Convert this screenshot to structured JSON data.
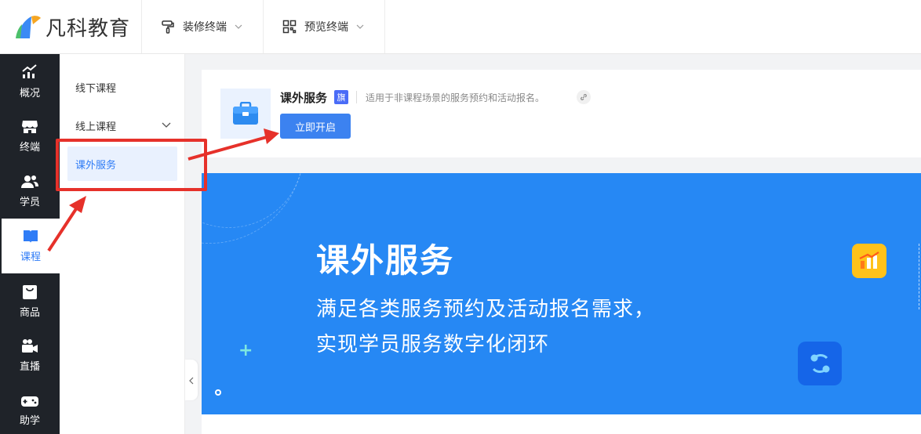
{
  "brand": {
    "name": "凡科教育"
  },
  "top_menu": [
    {
      "label": "装修终端",
      "icon": "paint-roller-icon"
    },
    {
      "label": "预览终端",
      "icon": "qr-code-icon"
    }
  ],
  "left_nav": [
    {
      "label": "概况",
      "icon": "chart-icon"
    },
    {
      "label": "终端",
      "icon": "store-icon"
    },
    {
      "label": "学员",
      "icon": "users-icon"
    },
    {
      "label": "课程",
      "icon": "book-icon",
      "active": true
    },
    {
      "label": "商品",
      "icon": "bag-icon"
    },
    {
      "label": "直播",
      "icon": "video-camera-icon"
    },
    {
      "label": "助学",
      "icon": "gamepad-icon"
    }
  ],
  "sub_nav": [
    {
      "label": "线下课程"
    },
    {
      "label": "线上课程",
      "expandable": true
    },
    {
      "label": "课外服务",
      "active": true
    }
  ],
  "card": {
    "title": "课外服务",
    "badge": "旗",
    "description": "适用于非课程场景的服务预约和活动报名。",
    "button_label": "立即开启"
  },
  "banner": {
    "title": "课外服务",
    "line1": "满足各类服务预约及活动报名需求，",
    "line2": "实现学员服务数字化闭环",
    "plus": "+"
  },
  "colors": {
    "primary": "#2f7cf6",
    "banner_bg": "#2688f4",
    "nav_bg": "#1f2329",
    "annotation": "#e6312a",
    "badge": "#4a6cf7"
  }
}
